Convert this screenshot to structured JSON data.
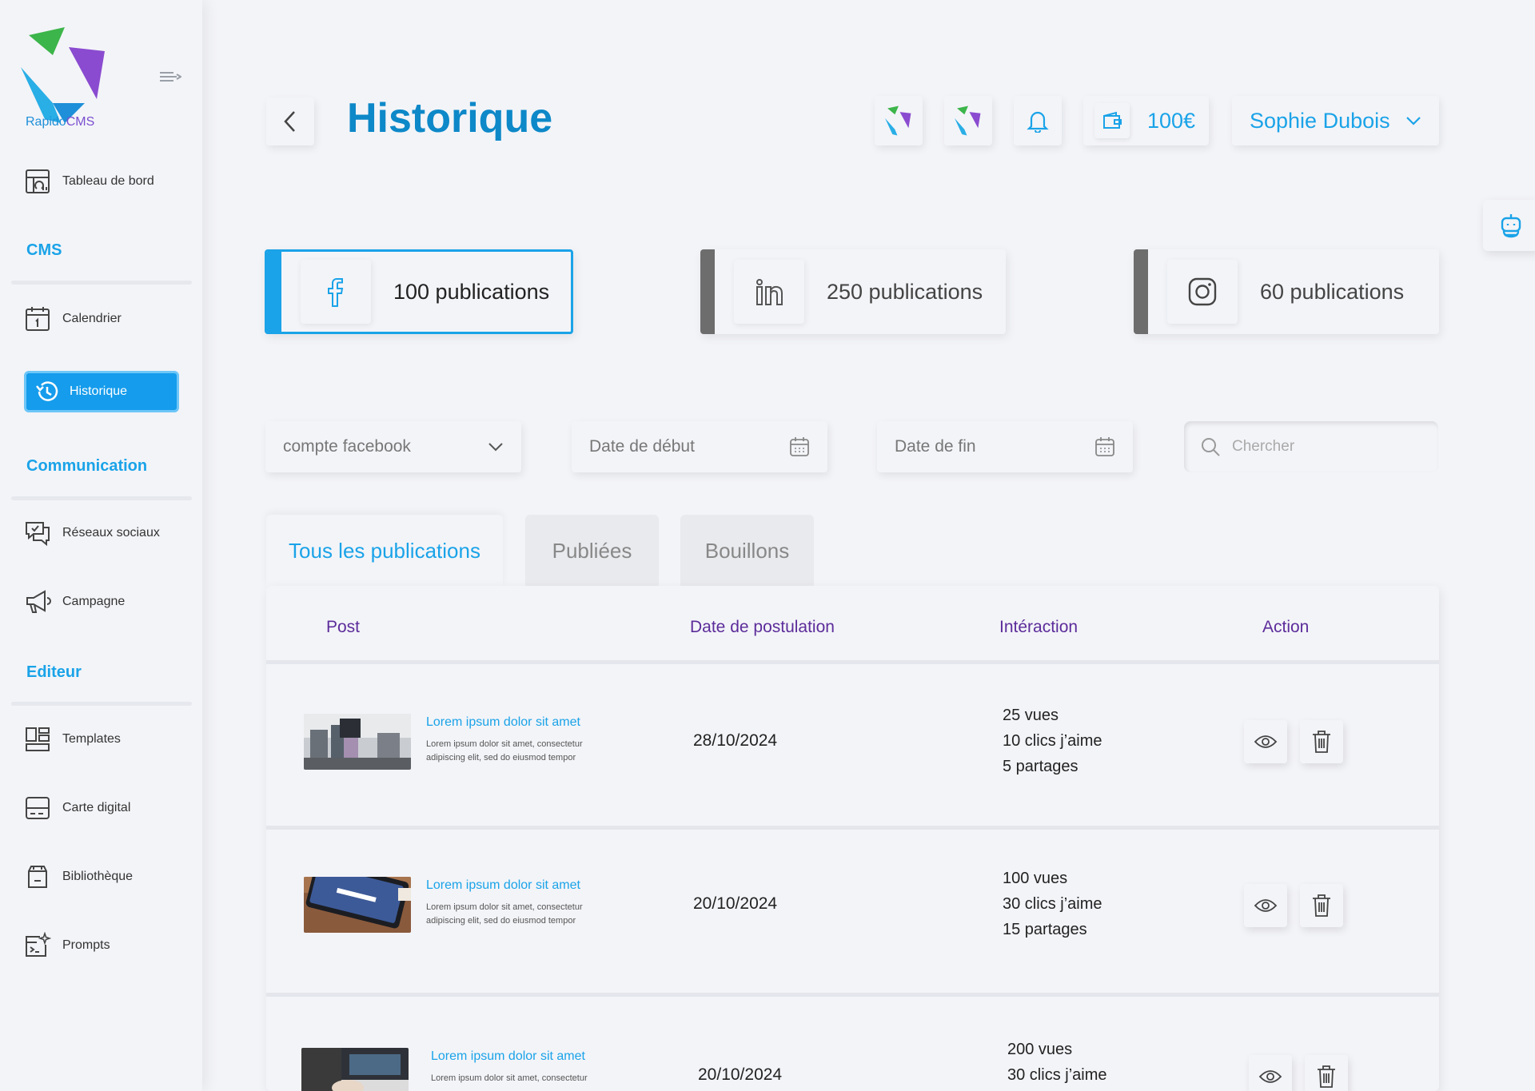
{
  "app": {
    "logo_name": "Rapido",
    "logo_suffix": "CMS"
  },
  "sidebar": {
    "dashboard": "Tableau de bord",
    "sections": [
      {
        "title": "CMS"
      },
      {
        "title": "Communication"
      },
      {
        "title": "Editeur"
      }
    ],
    "items": {
      "calendar": "Calendrier",
      "history": "Historique",
      "social": "Réseaux sociaux",
      "campaign": "Campagne",
      "templates": "Templates",
      "card": "Carte digital",
      "library": "Bibliothèque",
      "prompts": "Prompts"
    }
  },
  "header": {
    "title": "Historique",
    "wallet": "100€",
    "user": "Sophie Dubois"
  },
  "platforms": [
    {
      "name": "facebook",
      "label": "100 publications",
      "active": true
    },
    {
      "name": "linkedin",
      "label": "250 publications",
      "active": false
    },
    {
      "name": "instagram",
      "label": "60 publications",
      "active": false
    }
  ],
  "filters": {
    "account": "compte facebook",
    "start_date": "Date de début",
    "end_date": "Date de fin",
    "search_placeholder": "Chercher"
  },
  "tabs": [
    "Tous les publications",
    "Publiées",
    "Bouillons"
  ],
  "table": {
    "headers": [
      "Post",
      "Date de postulation",
      "Intéraction",
      "Action"
    ],
    "rows": [
      {
        "title": "Lorem ipsum dolor sit amet",
        "desc": "Lorem ipsum dolor sit amet, consectetur adipiscing elit, sed do eiusmod tempor",
        "date": "28/10/2024",
        "views": "25 vues",
        "likes": "10 clics j’aime",
        "shares": "5 partages"
      },
      {
        "title": "Lorem ipsum dolor sit amet",
        "desc": "Lorem ipsum dolor sit amet, consectetur adipiscing elit, sed do eiusmod tempor",
        "date": "20/10/2024",
        "views": "100 vues",
        "likes": "30 clics j’aime",
        "shares": "15 partages"
      },
      {
        "title": "Lorem ipsum dolor sit amet",
        "desc": "Lorem ipsum dolor sit amet, consectetur",
        "date": "20/10/2024",
        "views": "200 vues",
        "likes": "30 clics j’aime",
        "shares": ""
      }
    ]
  },
  "colors": {
    "accent": "#1aa3e8",
    "title": "#0d88c8",
    "header_text": "#5c2c9a",
    "background": "#f3f4f8"
  }
}
